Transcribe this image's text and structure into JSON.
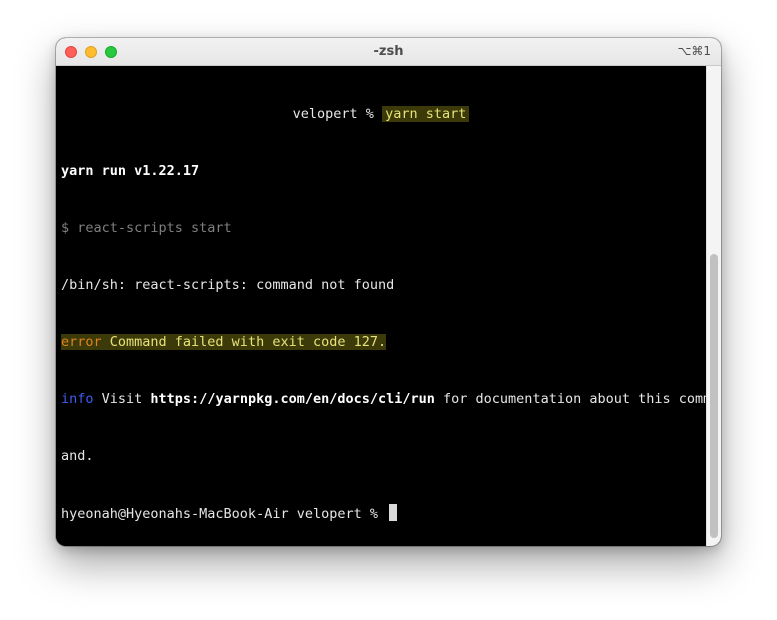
{
  "window": {
    "title": "-zsh",
    "shortcut": "⌥⌘1"
  },
  "terminal": {
    "prompt_line": {
      "prompt": "velopert % ",
      "command": "yarn start"
    },
    "yarn_version": "yarn run v1.22.17",
    "script_echo": "$ react-scripts start",
    "sh_error": "/bin/sh: react-scripts: command not found",
    "error_line": {
      "label": "error",
      "message": " Command failed with exit code 127."
    },
    "info_line": {
      "label": "info",
      "text_before": " Visit ",
      "url": "https://yarnpkg.com/en/docs/cli/run",
      "text_after": " for documentation about this comm",
      "continuation": "and."
    },
    "current_prompt": "hyeonah@Hyeonahs-MacBook-Air velopert % "
  },
  "colors": {
    "background": "#000000",
    "error": "#e0821e",
    "error_message": "#e8e27a",
    "highlight_bg": "#3b3a08",
    "info": "#3d5cf0"
  }
}
